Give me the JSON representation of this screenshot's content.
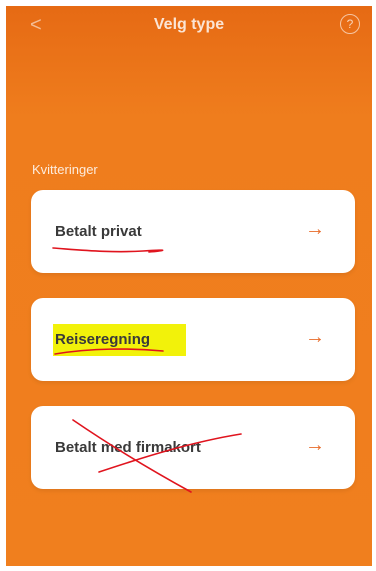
{
  "header": {
    "back_icon": "chevron-left-icon",
    "back_glyph": "<",
    "title": "Velg type",
    "help_icon": "help-circle-icon",
    "help_glyph": "?"
  },
  "section": {
    "label": "Kvitteringer"
  },
  "options": [
    {
      "label": "Betalt privat",
      "arrow_icon": "arrow-right-icon",
      "arrow_glyph": "→"
    },
    {
      "label": "Reiseregning",
      "arrow_icon": "arrow-right-icon",
      "arrow_glyph": "→"
    },
    {
      "label": "Betalt med firmakort",
      "arrow_icon": "arrow-right-icon",
      "arrow_glyph": "→"
    }
  ],
  "colors": {
    "background": "#ef7d1d",
    "card": "#ffffff",
    "arrow": "#e86c2a",
    "annotation_red": "#e0141e",
    "annotation_highlight": "#f2f20a"
  },
  "annotations": {
    "option_1": "underline",
    "option_2": "highlight-and-underline",
    "option_3": "crossed-out"
  }
}
